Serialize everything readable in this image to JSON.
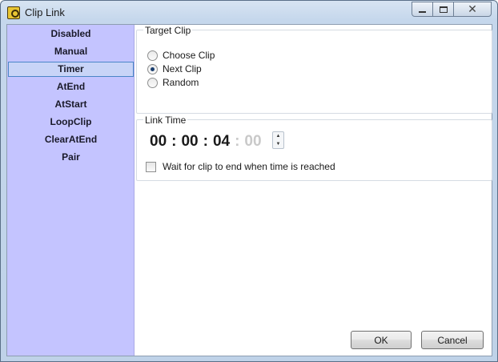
{
  "window": {
    "title": "Clip Link",
    "icon": "clip-link-app-icon",
    "controls": {
      "minimize": "minimize-icon",
      "maximize": "maximize-icon",
      "close": "close-icon"
    }
  },
  "sidebar": {
    "background": "#c4c4ff",
    "selected": "Timer",
    "items": [
      {
        "label": "Disabled"
      },
      {
        "label": "Manual"
      },
      {
        "label": "Timer"
      },
      {
        "label": "AtEnd"
      },
      {
        "label": "AtStart"
      },
      {
        "label": "LoopClip"
      },
      {
        "label": "ClearAtEnd"
      },
      {
        "label": "Pair"
      }
    ]
  },
  "target_clip": {
    "label": "Target Clip",
    "options": [
      {
        "label": "Choose Clip",
        "checked": false
      },
      {
        "label": "Next Clip",
        "checked": true
      },
      {
        "label": "Random",
        "checked": false
      }
    ]
  },
  "link_time": {
    "label": "Link Time",
    "hours": "00",
    "minutes": "00",
    "seconds": "04",
    "frames": "00",
    "separator": ":",
    "wait_checkbox": {
      "label": "Wait for clip to end when time is reached",
      "checked": false
    }
  },
  "buttons": {
    "ok": "OK",
    "cancel": "Cancel"
  }
}
